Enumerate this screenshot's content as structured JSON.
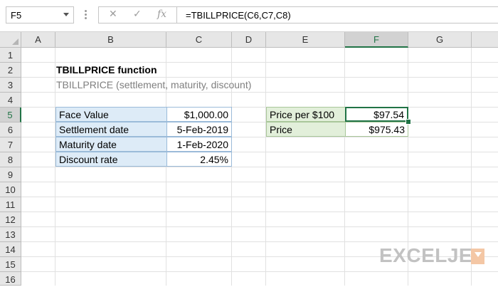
{
  "formula_bar": {
    "name_box": "F5",
    "cancel_icon": "✕",
    "enter_icon": "✓",
    "function_icon": "fx",
    "formula": "=TBILLPRICE(C6,C7,C8)"
  },
  "columns": [
    "A",
    "B",
    "C",
    "D",
    "E",
    "F",
    "G"
  ],
  "rows": [
    "1",
    "2",
    "3",
    "4",
    "5",
    "6",
    "7",
    "8",
    "9",
    "10",
    "11",
    "12",
    "13",
    "14",
    "15",
    "16"
  ],
  "active_cell": {
    "column": "F",
    "row": "5"
  },
  "sheet": {
    "title": "TBILLPRICE function",
    "subtitle": "TBILLPRICE (settlement, maturity, discount)",
    "inputs": [
      {
        "label": "Face Value",
        "value": "$1,000.00"
      },
      {
        "label": "Settlement date",
        "value": "5-Feb-2019"
      },
      {
        "label": "Maturity date",
        "value": "1-Feb-2020"
      },
      {
        "label": "Discount rate",
        "value": "2.45%"
      }
    ],
    "results": [
      {
        "label": "Price per $100",
        "value": "$97.54"
      },
      {
        "label": "Price",
        "value": "$975.43"
      }
    ]
  },
  "watermark": {
    "text": "EXCELJET"
  },
  "colors": {
    "accent": "#217346",
    "input_label_fill": "#ddebf7",
    "result_label_fill": "#e2efda"
  }
}
